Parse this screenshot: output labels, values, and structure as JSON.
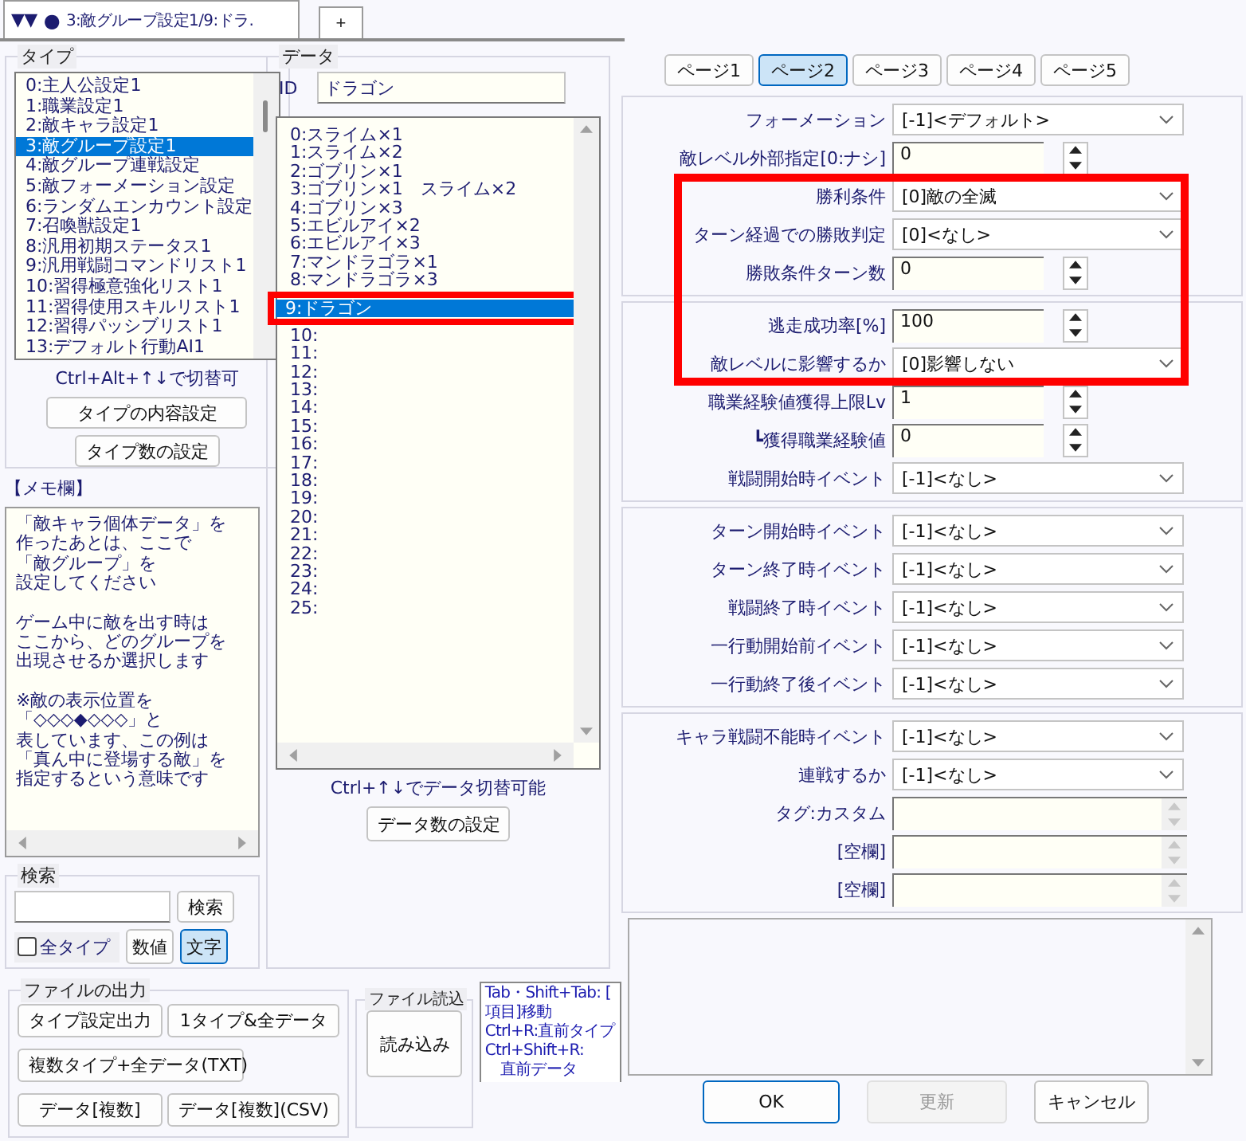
{
  "window": {
    "arrows": "▼▼",
    "dot": "●",
    "title": "3:敵グループ設定1/9:ドラ.",
    "new_tab": "+"
  },
  "type_panel": {
    "title": "タイプ",
    "items": [
      {
        "text": "0:主人公設定1",
        "selected": false
      },
      {
        "text": "1:職業設定1",
        "selected": false
      },
      {
        "text": "2:敵キャラ設定1",
        "selected": false
      },
      {
        "text": "3:敵グループ設定1",
        "selected": true
      },
      {
        "text": "4:敵グループ連戦設定",
        "selected": false
      },
      {
        "text": "5:敵フォーメーション設定",
        "selected": false
      },
      {
        "text": "6:ランダムエンカウント設定",
        "selected": false
      },
      {
        "text": "7:召喚獣設定1",
        "selected": false
      },
      {
        "text": "8:汎用初期ステータス1",
        "selected": false
      },
      {
        "text": "9:汎用戦闘コマンドリスト1",
        "selected": false
      },
      {
        "text": "10:習得極意強化リスト1",
        "selected": false
      },
      {
        "text": "11:習得使用スキルリスト1",
        "selected": false
      },
      {
        "text": "12:習得パッシブリスト1",
        "selected": false
      },
      {
        "text": "13:デフォルト行動AI1",
        "selected": false
      }
    ],
    "hint": "Ctrl+Alt+↑↓で切替可",
    "buttons": [
      "タイプの内容設定",
      "タイプ数の設定"
    ]
  },
  "memo": {
    "title": "【メモ欄】",
    "paragraphs": [
      [
        "「敵キャラ個体データ」を",
        "作ったあとは、ここで",
        "「敵グループ」を",
        "設定してください"
      ],
      [
        "ゲーム中に敵を出す時は",
        "ここから、どのグループを",
        "出現させるか選択します"
      ],
      [
        "※敵の表示位置を",
        "「◇◇◇◆◇◇◇」と",
        "表しています、この例は",
        "「真ん中に登場する敵」を",
        "指定するという意味です"
      ]
    ]
  },
  "search": {
    "title": "検索",
    "button": "検索",
    "all_types": {
      "label": "全タイプ",
      "checked": false
    },
    "modes": [
      {
        "label": "数値",
        "selected": false
      },
      {
        "label": "文字",
        "selected": true
      }
    ]
  },
  "file_output": {
    "title": "ファイルの出力",
    "buttons": [
      "タイプ設定出力",
      "1タイプ&全データ",
      "複数タイプ+全データ(TXT)",
      "データ[複数]",
      "データ[複数](CSV)"
    ]
  },
  "data_panel": {
    "title": "データ",
    "id_label": "ID",
    "name": "ドラゴン",
    "items": [
      {
        "text": "0:スライム×1",
        "selected": false,
        "annotated": false
      },
      {
        "text": "1:スライム×2",
        "selected": false,
        "annotated": false
      },
      {
        "text": "2:ゴブリン×1",
        "selected": false,
        "annotated": false
      },
      {
        "text": "3:ゴブリン×1　スライム×2",
        "selected": false,
        "annotated": false
      },
      {
        "text": "4:ゴブリン×3",
        "selected": false,
        "annotated": false
      },
      {
        "text": "5:エビルアイ×2",
        "selected": false,
        "annotated": false
      },
      {
        "text": "6:エビルアイ×3",
        "selected": false,
        "annotated": false
      },
      {
        "text": "7:マンドラゴラ×1",
        "selected": false,
        "annotated": false
      },
      {
        "text": "8:マンドラゴラ×3",
        "selected": false,
        "annotated": false
      },
      {
        "text": "9:ドラゴン",
        "selected": true,
        "annotated": true
      },
      {
        "text": "10:",
        "selected": false,
        "annotated": false
      },
      {
        "text": "11:",
        "selected": false,
        "annotated": false
      },
      {
        "text": "12:",
        "selected": false,
        "annotated": false
      },
      {
        "text": "13:",
        "selected": false,
        "annotated": false
      },
      {
        "text": "14:",
        "selected": false,
        "annotated": false
      },
      {
        "text": "15:",
        "selected": false,
        "annotated": false
      },
      {
        "text": "16:",
        "selected": false,
        "annotated": false
      },
      {
        "text": "17:",
        "selected": false,
        "annotated": false
      },
      {
        "text": "18:",
        "selected": false,
        "annotated": false
      },
      {
        "text": "19:",
        "selected": false,
        "annotated": false
      },
      {
        "text": "20:",
        "selected": false,
        "annotated": false
      },
      {
        "text": "21:",
        "selected": false,
        "annotated": false
      },
      {
        "text": "22:",
        "selected": false,
        "annotated": false
      },
      {
        "text": "23:",
        "selected": false,
        "annotated": false
      },
      {
        "text": "24:",
        "selected": false,
        "annotated": false
      },
      {
        "text": "25:",
        "selected": false,
        "annotated": false
      }
    ],
    "hint": "Ctrl+↑↓でデータ切替可能",
    "button": "データ数の設定"
  },
  "file_read": {
    "title": "ファイル読込",
    "button": "読み込み"
  },
  "shortcuts": "Tab・Shift+Tab: [\n項目]移動\nCtrl+R:直前タイプ\nCtrl+Shift+R:\n　直前データ",
  "page_tabs": [
    {
      "label": "ページ1",
      "selected": false
    },
    {
      "label": "ページ2",
      "selected": true
    },
    {
      "label": "ページ3",
      "selected": false
    },
    {
      "label": "ページ4",
      "selected": false
    },
    {
      "label": "ページ5",
      "selected": false
    }
  ],
  "groups": [
    [
      {
        "kind": "select",
        "label": "フォーメーション",
        "value": "[-1]<デフォルト>",
        "annotated": false
      },
      {
        "kind": "spin",
        "label": "敵レベル外部指定[0:ナシ]",
        "value": "0",
        "annotated": false
      },
      {
        "kind": "select",
        "label": "勝利条件",
        "value": "[0]敵の全滅",
        "annotated": true
      },
      {
        "kind": "select",
        "label": "ターン経過での勝敗判定",
        "value": "[0]<なし>",
        "annotated": true
      },
      {
        "kind": "spin",
        "label": "勝敗条件ターン数",
        "value": "0",
        "annotated": true
      }
    ],
    [
      {
        "kind": "spin",
        "label": "逃走成功率[%]",
        "value": "100",
        "annotated": true
      },
      {
        "kind": "select",
        "label": "敵レベルに影響するか",
        "value": "[0]影響しない",
        "annotated": true
      },
      {
        "kind": "spin",
        "label": "職業経験値獲得上限Lv",
        "value": "1",
        "annotated": false
      },
      {
        "kind": "spin",
        "label": "┗獲得職業経験値",
        "value": "0",
        "annotated": false
      },
      {
        "kind": "select",
        "label": "戦闘開始時イベント",
        "value": "[-1]<なし>",
        "annotated": false
      }
    ],
    [
      {
        "kind": "select",
        "label": "ターン開始時イベント",
        "value": "[-1]<なし>",
        "annotated": false
      },
      {
        "kind": "select",
        "label": "ターン終了時イベント",
        "value": "[-1]<なし>",
        "annotated": false
      },
      {
        "kind": "select",
        "label": "戦闘終了時イベント",
        "value": "[-1]<なし>",
        "annotated": false
      },
      {
        "kind": "select",
        "label": "一行動開始前イベント",
        "value": "[-1]<なし>",
        "annotated": false
      },
      {
        "kind": "select",
        "label": "一行動終了後イベント",
        "value": "[-1]<なし>",
        "annotated": false
      }
    ],
    [
      {
        "kind": "select",
        "label": "キャラ戦闘不能時イベント",
        "value": "[-1]<なし>",
        "annotated": false
      },
      {
        "kind": "select",
        "label": "連戦するか",
        "value": "[-1]<なし>",
        "annotated": false
      },
      {
        "kind": "text",
        "label": "タグ:カスタム",
        "annotated": false
      },
      {
        "kind": "text",
        "label": "[空欄]",
        "annotated": false
      },
      {
        "kind": "text",
        "label": "[空欄]",
        "annotated": false
      }
    ]
  ],
  "footer_buttons": [
    {
      "label": "OK",
      "default": true,
      "disabled": false
    },
    {
      "label": "更新",
      "default": false,
      "disabled": true
    },
    {
      "label": "キャンセル",
      "default": false,
      "disabled": false
    }
  ]
}
